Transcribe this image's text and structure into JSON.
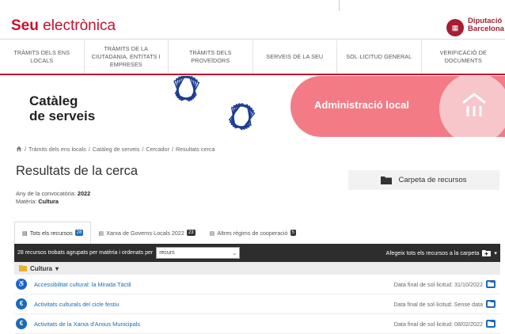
{
  "header": {
    "brand_bold": "Seu",
    "brand_rest": " electrònica",
    "org_line1": "Diputació",
    "org_line2": "Barcelona"
  },
  "nav": [
    {
      "label": "TRÀMITS DELS ENS LOCALS"
    },
    {
      "label": "TRÀMITS DE LA CIUTADANIA, ENTITATS I EMPRESES"
    },
    {
      "label": "TRÀMITS DELS PROVEÏDORS"
    },
    {
      "label": "SERVEIS DE LA SEU"
    },
    {
      "label": "SOL·LICITUD GENERAL"
    },
    {
      "label": "VERIFICACIÓ DE DOCUMENTS"
    }
  ],
  "banner": {
    "title_line1": "Catàleg",
    "title_line2": "de serveis",
    "section": "Administració local"
  },
  "breadcrumb": {
    "items": [
      "Tràmits dels ens locals",
      "Catàleg de serveis",
      "Cercador",
      "Resultats cerca"
    ],
    "separator": "/"
  },
  "page": {
    "title": "Resultats de la cerca",
    "year_label": "Any de la convocatòria:",
    "year_value": "2022",
    "subject_label": "Matèria:",
    "subject_value": "Cultura",
    "folder_button": "Carpeta de recursos"
  },
  "tabs": [
    {
      "label": "Tots els recursos",
      "count": "28",
      "active": true
    },
    {
      "label": "Xarxa de Governs Locals 2022",
      "count": "23",
      "active": false
    },
    {
      "label": "Altres règims de cooperació",
      "count": "5",
      "active": false
    }
  ],
  "filterbar": {
    "summary": "28 recursos trobats agrupats per matèria i ordenats per",
    "sort_value": "recurs",
    "add_all": "Afegeix tots els recursos a la carpeta"
  },
  "category": {
    "label": "Cultura"
  },
  "resources": [
    {
      "title": "Accessibilitat cultural: la Mirada Tàctil",
      "deadline_label": "Data final de sol·licitud:",
      "deadline": "31/10/2022",
      "icon": "accessibility-icon"
    },
    {
      "title": "Activitats culturals del cicle festiu",
      "deadline_label": "Data final de sol·licitud:",
      "deadline": "Sense data",
      "icon": "euro-icon"
    },
    {
      "title": "Activitats de la Xarxa d'Arxius Municipals",
      "deadline_label": "Data final de sol·licitud:",
      "deadline": "08/02/2022",
      "icon": "euro-icon"
    }
  ],
  "colors": {
    "brand_red": "#c8102e",
    "banner_pink": "#f27b86",
    "link_blue": "#1a6bb8",
    "filter_bg": "#2d2d2d"
  }
}
